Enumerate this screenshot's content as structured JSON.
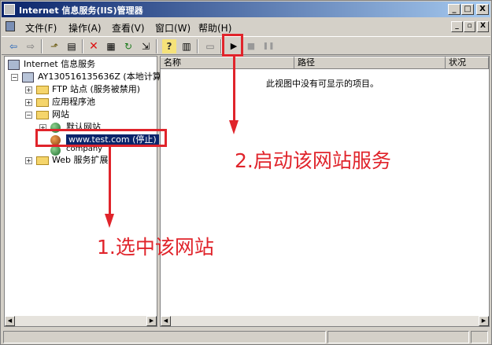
{
  "window": {
    "title": "Internet 信息服务(IIS)管理器",
    "controls": {
      "minimize": "_",
      "maximize": "□",
      "close": "X"
    }
  },
  "menubar": {
    "items": [
      {
        "label": "文件(F)"
      },
      {
        "label": "操作(A)"
      },
      {
        "label": "查看(V)"
      },
      {
        "label": "窗口(W)"
      },
      {
        "label": "帮助(H)"
      }
    ],
    "mdi_controls": {
      "minimize": "_",
      "restore": "▫",
      "close": "X"
    }
  },
  "toolbar": {
    "buttons": [
      {
        "icon": "back-arrow-icon",
        "glyph": "⇦"
      },
      {
        "icon": "forward-arrow-icon",
        "glyph": "⇨"
      },
      {
        "icon": "up-folder-icon",
        "glyph": "⬏"
      },
      {
        "icon": "show-tree-icon",
        "glyph": "▤"
      },
      {
        "icon": "delete-icon",
        "glyph": "✕"
      },
      {
        "icon": "properties-icon",
        "glyph": "▦"
      },
      {
        "icon": "refresh-icon",
        "glyph": "↻"
      },
      {
        "icon": "export-list-icon",
        "glyph": "⇲"
      },
      {
        "icon": "help-icon",
        "glyph": "?"
      },
      {
        "icon": "show-hide-console-icon",
        "glyph": "▥"
      },
      {
        "icon": "computer-icon",
        "glyph": "▭"
      },
      {
        "icon": "start-icon",
        "glyph": "▶"
      },
      {
        "icon": "stop-icon",
        "glyph": "■"
      },
      {
        "icon": "pause-icon",
        "glyph": "❚❚"
      }
    ]
  },
  "tree": {
    "items": [
      {
        "label": "Internet 信息服务",
        "icon": "iis-icon"
      },
      {
        "label": "AY130516135636Z (本地计算机",
        "icon": "computer-icon",
        "expander": "−"
      },
      {
        "label": "FTP 站点 (服务被禁用)",
        "icon": "folder-icon",
        "expander": "+"
      },
      {
        "label": "应用程序池",
        "icon": "folder-icon",
        "expander": "+"
      },
      {
        "label": "网站",
        "icon": "folder-icon",
        "expander": "−"
      },
      {
        "label": "默认网站",
        "icon": "globe-icon",
        "expander": "+"
      },
      {
        "label": "www.test.com (停止)",
        "icon": "globe-icon",
        "selected": true
      },
      {
        "label": "company",
        "icon": "globe-icon"
      },
      {
        "label": "Web 服务扩展",
        "icon": "folder-icon",
        "expander": "+"
      }
    ]
  },
  "list": {
    "columns": [
      {
        "label": "名称"
      },
      {
        "label": "路径"
      },
      {
        "label": "状况"
      }
    ],
    "empty_message": "此视图中没有可显示的项目。"
  },
  "annotations": {
    "step1": "1.选中该网站",
    "step2": "2.启动该网站服务",
    "color": "#e0242b"
  },
  "colors": {
    "titlebar_start": "#0a246a",
    "titlebar_end": "#a6caf0",
    "selection": "#0a246a"
  }
}
